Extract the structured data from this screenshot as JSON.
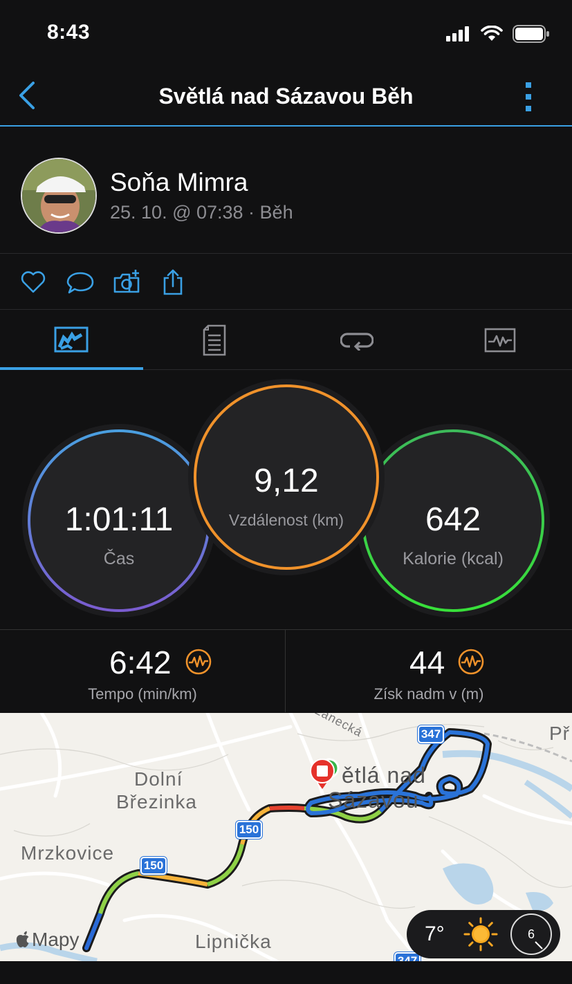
{
  "status": {
    "time": "8:43"
  },
  "nav": {
    "title": "Světlá nad Sázavou Běh"
  },
  "profile": {
    "name": "Soňa Mimra",
    "meta": "25. 10. @ 07:38 · Běh"
  },
  "rings": {
    "time": {
      "value": "1:01:11",
      "label": "Čas",
      "color_top": "#4a9fe0",
      "color_bottom": "#7a5ccf"
    },
    "distance": {
      "value": "9,12",
      "label": "Vzdálenost (km)",
      "color": "#f0922b"
    },
    "calories": {
      "value": "642",
      "label": "Kalorie (kcal)",
      "color_top": "#3dba5a",
      "color_bottom": "#38e03a"
    }
  },
  "stats": {
    "pace": {
      "value": "6:42",
      "label": "Tempo (min/km)"
    },
    "elevation": {
      "value": "44",
      "label": "Získ nadm v (m)"
    }
  },
  "map": {
    "labels": {
      "lanecka": "Lánecká",
      "pr": "Př",
      "town": "ětlá nad",
      "town2": "Sázavou",
      "dolni": "Dolní",
      "brezinka": "Březinka",
      "mrzkovice": "Mrzkovice",
      "lipnicka": "Lipnička",
      "road_347": "347",
      "road_150a": "150",
      "road_150b": "150",
      "road_347b": "347"
    },
    "attribution": "Mapy",
    "weather": {
      "temp": "7°",
      "wind": "6"
    }
  }
}
